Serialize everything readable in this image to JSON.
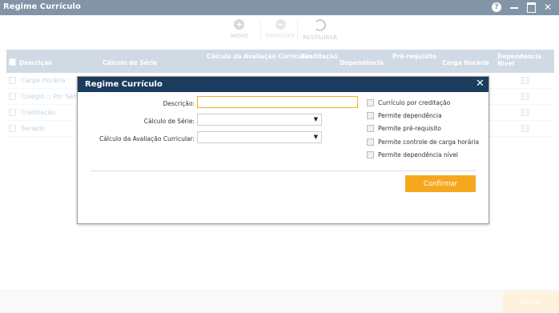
{
  "window": {
    "title": "Regime Currículo"
  },
  "toolbar": {
    "new_label": "NOVO",
    "remove_label": "REMOVER",
    "restore_label": "RESTAURAR"
  },
  "grid": {
    "columns": [
      "Descrição",
      "Cálculo de Série",
      "Cálculo da Avaliação Curricular",
      "Creditação",
      "Dependência",
      "Pré-requisito",
      "Carga Horária",
      "Dependencia Nivel"
    ],
    "rows": [
      {
        "descricao": "Carga Horária"
      },
      {
        "descricao": "Colégio :: Por Série"
      },
      {
        "descricao": "Creditação"
      },
      {
        "descricao": "Seriado"
      }
    ]
  },
  "footer": {
    "save_label": "Salvar"
  },
  "dialog": {
    "title": "Regime Currículo",
    "fields": {
      "descricao_label": "Descrição:",
      "descricao_value": "",
      "calculo_serie_label": "Cálculo de Série:",
      "calculo_serie_value": "",
      "calculo_avaliacao_label": "Cálculo da Avaliação Curricular:",
      "calculo_avaliacao_value": ""
    },
    "options": [
      {
        "label": "Currículo por creditação",
        "checked": false
      },
      {
        "label": "Permite dependência",
        "checked": false
      },
      {
        "label": "Permite pré-requisito",
        "checked": false
      },
      {
        "label": "Permite controle de carga horária",
        "checked": false
      },
      {
        "label": "Permite dependência nível",
        "checked": false
      }
    ],
    "confirm_label": "Confirmar"
  },
  "colors": {
    "titlebar": "#1c3c5f",
    "grid_header": "#a9bccf",
    "accent": "#f5a81d",
    "link": "#8bb0d6"
  },
  "icons": {
    "help": "help-icon",
    "minimize": "minimize-icon",
    "maximize": "maximize-icon",
    "close": "close-icon",
    "new": "plus-circle-icon",
    "remove": "minus-circle-icon",
    "restore": "restore-icon"
  }
}
